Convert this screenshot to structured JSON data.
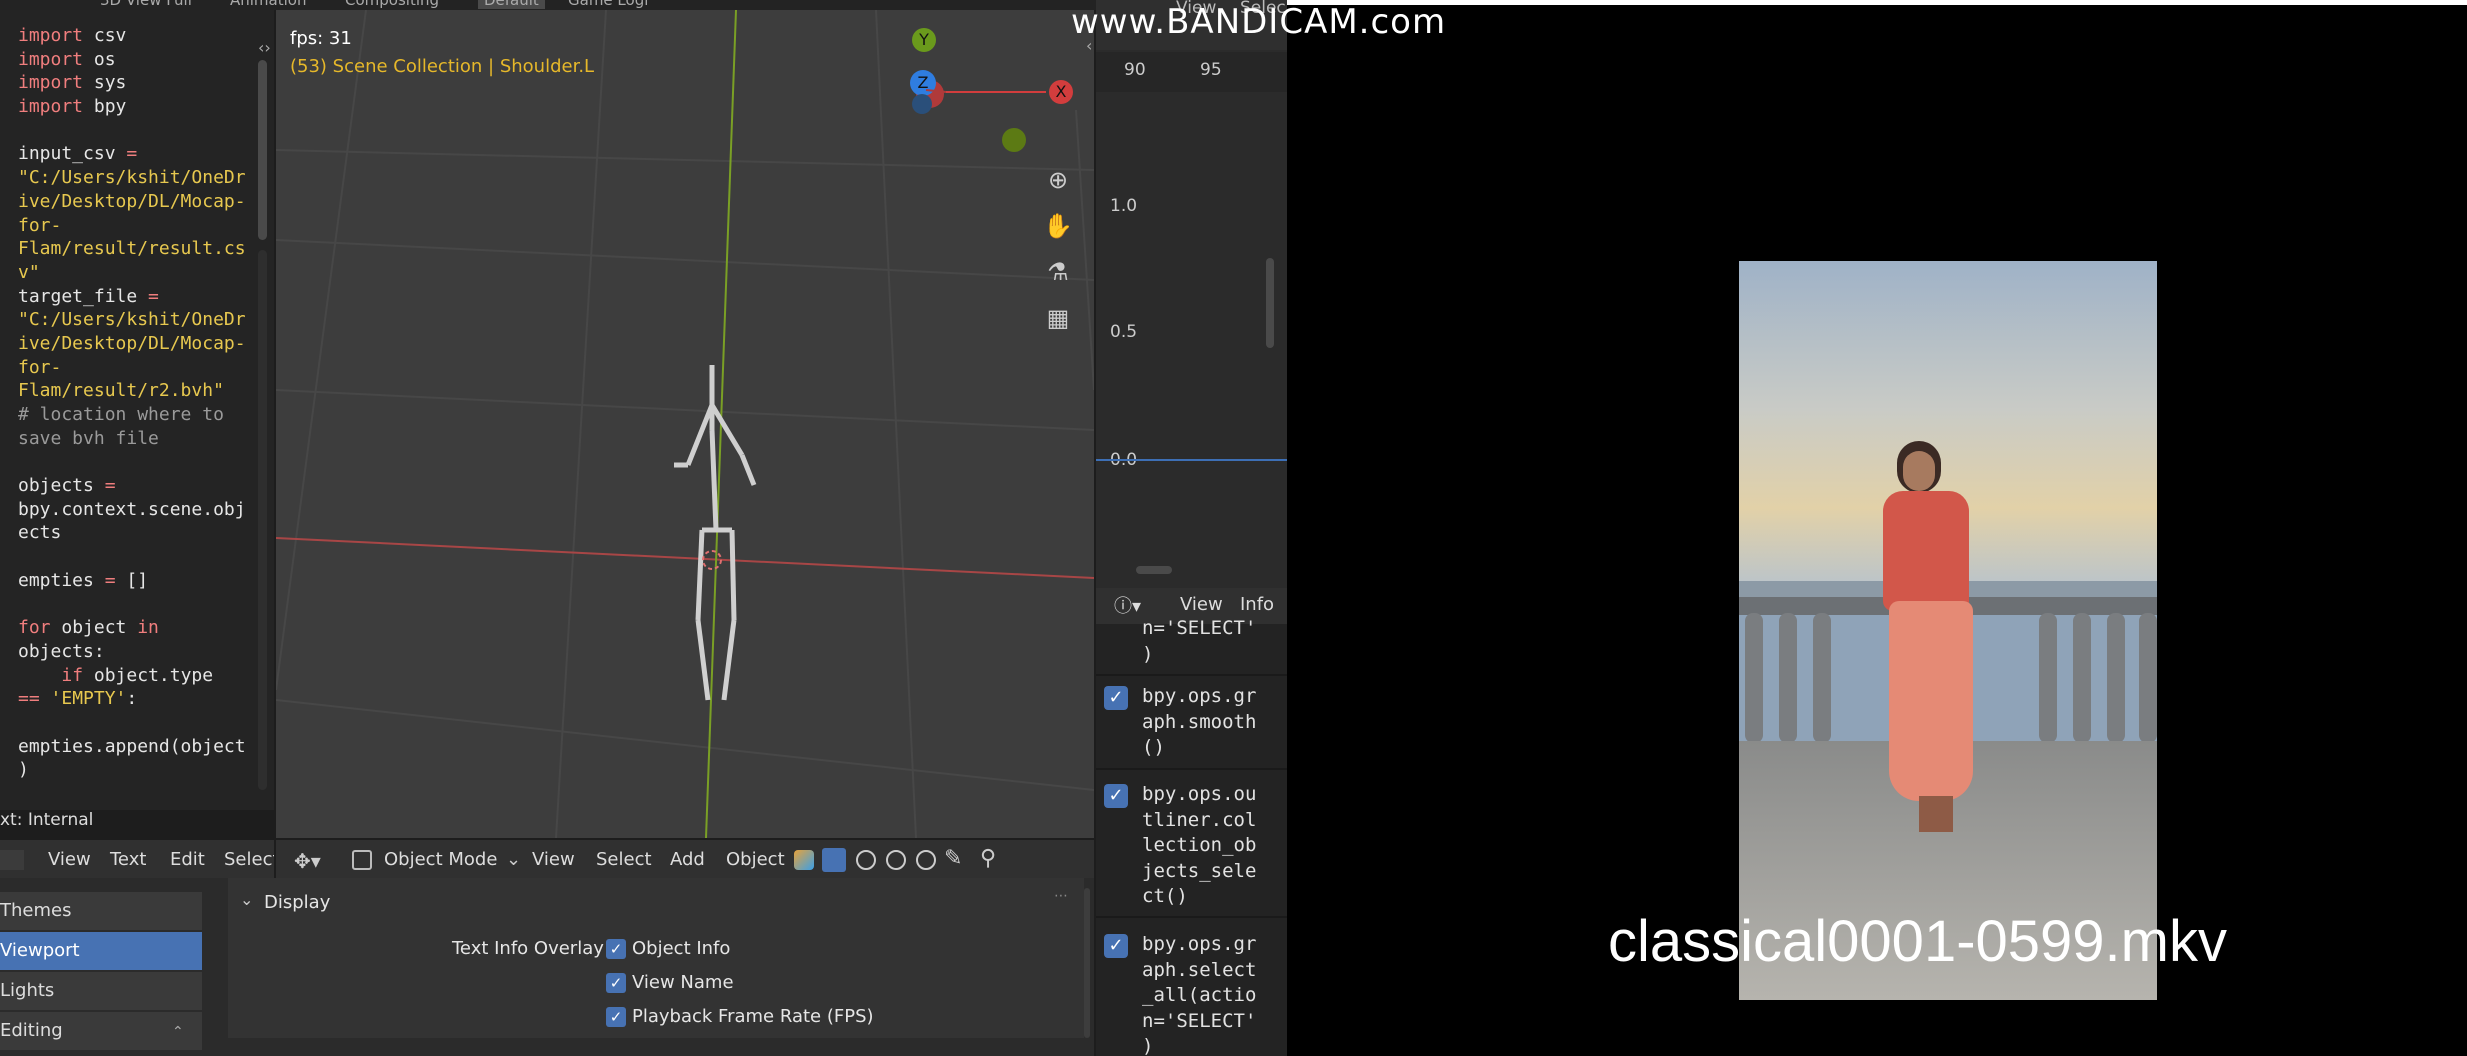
{
  "top_menu": [
    "3D View Full",
    "Animation",
    "Compositing",
    "Default",
    "Game Logi"
  ],
  "text_editor": {
    "code": [
      {
        "t": [
          {
            "k": "kw",
            "v": "import"
          },
          {
            "v": " csv"
          }
        ]
      },
      {
        "t": [
          {
            "k": "kw",
            "v": "import"
          },
          {
            "v": " os"
          }
        ]
      },
      {
        "t": [
          {
            "k": "kw",
            "v": "import"
          },
          {
            "v": " sys"
          }
        ]
      },
      {
        "t": [
          {
            "k": "kw",
            "v": "import"
          },
          {
            "v": " bpy"
          }
        ]
      },
      {
        "t": [
          {
            "v": ""
          }
        ]
      },
      {
        "t": [
          {
            "v": "input_csv "
          },
          {
            "k": "kw",
            "v": "="
          }
        ]
      },
      {
        "t": [
          {
            "k": "str",
            "v": "\"C:/Users/kshit/OneDr"
          }
        ]
      },
      {
        "t": [
          {
            "k": "str",
            "v": "ive/Desktop/DL/Mocap-"
          }
        ]
      },
      {
        "t": [
          {
            "k": "str",
            "v": "for-"
          }
        ]
      },
      {
        "t": [
          {
            "k": "str",
            "v": "Flam/result/result.cs"
          }
        ]
      },
      {
        "t": [
          {
            "k": "str",
            "v": "v\""
          }
        ]
      },
      {
        "t": [
          {
            "v": "target_file "
          },
          {
            "k": "kw",
            "v": "="
          }
        ]
      },
      {
        "t": [
          {
            "k": "str",
            "v": "\"C:/Users/kshit/OneDr"
          }
        ]
      },
      {
        "t": [
          {
            "k": "str",
            "v": "ive/Desktop/DL/Mocap-"
          }
        ]
      },
      {
        "t": [
          {
            "k": "str",
            "v": "for-"
          }
        ]
      },
      {
        "t": [
          {
            "k": "str",
            "v": "Flam/result/r2.bvh\""
          }
        ]
      },
      {
        "t": [
          {
            "k": "cm",
            "v": "# location where to"
          }
        ]
      },
      {
        "t": [
          {
            "k": "cm",
            "v": "save bvh file"
          }
        ]
      },
      {
        "t": [
          {
            "v": ""
          }
        ]
      },
      {
        "t": [
          {
            "v": "objects "
          },
          {
            "k": "kw",
            "v": "="
          }
        ]
      },
      {
        "t": [
          {
            "v": "bpy.context.scene.obj"
          }
        ]
      },
      {
        "t": [
          {
            "v": "ects"
          }
        ]
      },
      {
        "t": [
          {
            "v": ""
          }
        ]
      },
      {
        "t": [
          {
            "v": "empties "
          },
          {
            "k": "kw",
            "v": "="
          },
          {
            "v": " []"
          }
        ]
      },
      {
        "t": [
          {
            "v": ""
          }
        ]
      },
      {
        "t": [
          {
            "k": "kw",
            "v": "for"
          },
          {
            "v": " object "
          },
          {
            "k": "kw",
            "v": "in"
          }
        ]
      },
      {
        "t": [
          {
            "v": "objects:"
          }
        ]
      },
      {
        "t": [
          {
            "v": "    "
          },
          {
            "k": "kw",
            "v": "if"
          },
          {
            "v": " object.type"
          }
        ]
      },
      {
        "t": [
          {
            "k": "kw",
            "v": "=="
          },
          {
            "v": " "
          },
          {
            "k": "str",
            "v": "'EMPTY'"
          },
          {
            "v": ":"
          }
        ]
      },
      {
        "t": [
          {
            "v": ""
          }
        ]
      },
      {
        "t": [
          {
            "v": "empties.append(object"
          }
        ]
      },
      {
        "t": [
          {
            "v": ")"
          }
        ]
      }
    ],
    "status": "xt: Internal",
    "menu": [
      "View",
      "Text",
      "Edit",
      "Select"
    ]
  },
  "viewport": {
    "fps": "fps: 31",
    "collection": "(53) Scene Collection | Shoulder.L",
    "axes": {
      "y": "Y",
      "z": "Z",
      "x": "X"
    },
    "header": {
      "mode": "Object Mode",
      "menu": [
        "View",
        "Select",
        "Add",
        "Object"
      ]
    }
  },
  "graph": {
    "top_menu": [
      "View",
      "Selec"
    ],
    "frames": [
      "90",
      "95"
    ],
    "yvalues": [
      "1.0",
      "0.5",
      "0.0"
    ]
  },
  "info": {
    "menu": [
      "View",
      "Info"
    ],
    "partial_top": [
      "n='SELECT'",
      ")"
    ],
    "entries": [
      {
        "lines": [
          "bpy.ops.gr",
          "aph.smooth",
          "()"
        ]
      },
      {
        "lines": [
          "bpy.ops.ou",
          "tliner.col",
          "lection_ob",
          "jects_sele",
          "ct()"
        ]
      },
      {
        "lines": [
          "bpy.ops.gr",
          "aph.select",
          "_all(actio",
          "n='SELECT'",
          ")"
        ]
      }
    ]
  },
  "prefs": {
    "sidebar": [
      "Themes",
      "Viewport",
      "Lights",
      "Editing"
    ],
    "section": "Display",
    "overlay_label": "Text Info Overlay",
    "options": [
      "Object Info",
      "View Name",
      "Playback Frame Rate (FPS)"
    ]
  },
  "video": {
    "watermark": "www.BANDICAM.com",
    "filename": "classical0001-0599.mkv"
  },
  "colors": {
    "accent": "#4772b3",
    "keyword": "#f07e7e",
    "string": "#e7c84f",
    "collection": "#e6b82a"
  }
}
